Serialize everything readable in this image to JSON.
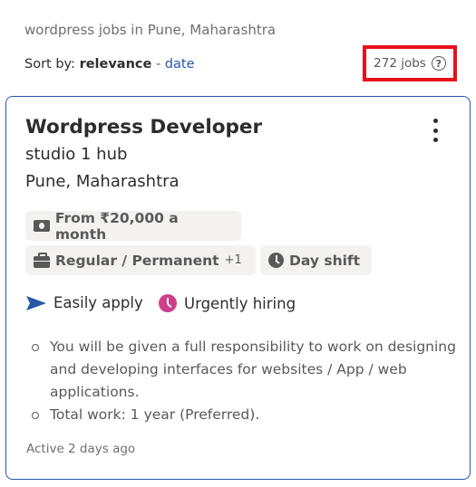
{
  "search": {
    "query_text": "wordpress jobs in Pune, Maharashtra"
  },
  "sort": {
    "label": "Sort by:",
    "active_option": "relevance",
    "separator": " - ",
    "alt_option": "date"
  },
  "results": {
    "count_text": "272 jobs",
    "help_icon": "?",
    "highlight_color": "#e8101a"
  },
  "job_card": {
    "title": "Wordpress Developer",
    "company": "studio 1 hub",
    "location": "Pune, Maharashtra",
    "salary": "From ₹20,000 a month",
    "job_type": "Regular / Permanent",
    "job_type_more": "+1",
    "shift": "Day shift",
    "easily_apply": "Easily apply",
    "urgently_hiring": "Urgently hiring",
    "snippet": [
      "You will be given a full responsibility to work on designing and developing interfaces for websites / App / web applications.",
      "Total work: 1 year (Preferred)."
    ],
    "active_date": "Active 2 days ago",
    "accent_color": "#2557a7",
    "urgent_color": "#cd3f8a"
  }
}
